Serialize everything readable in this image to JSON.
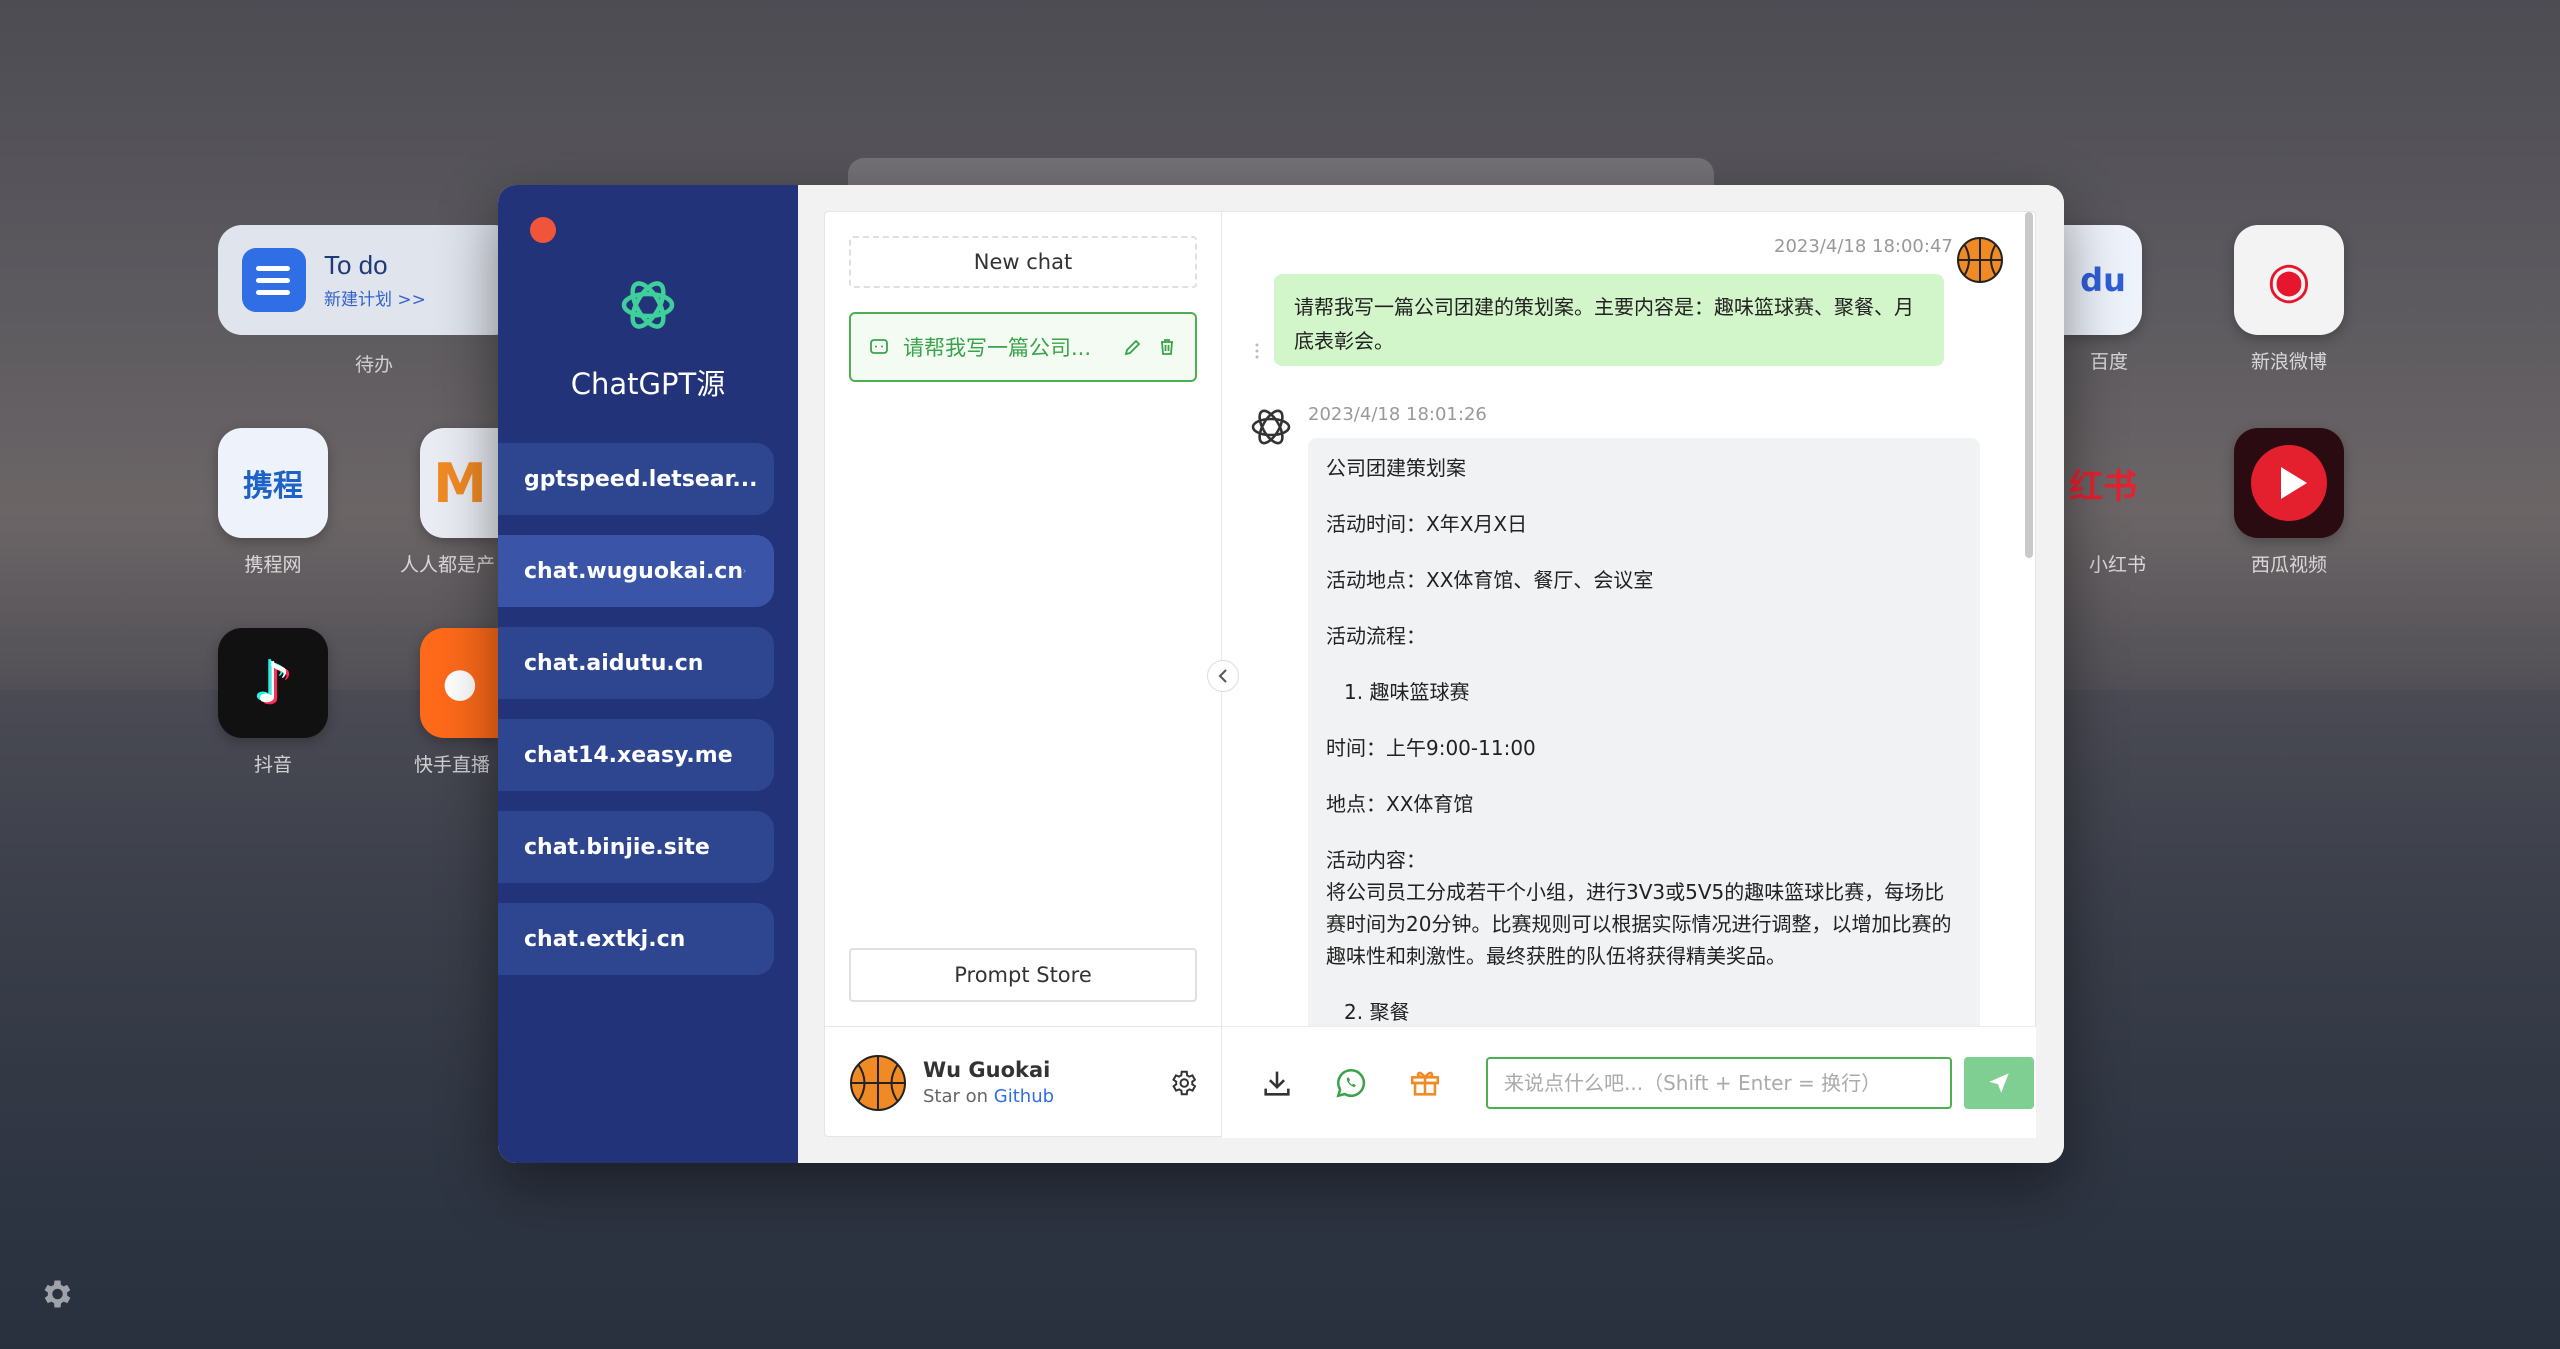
{
  "desktop": {
    "todo_widget": {
      "title": "To do",
      "subtitle": "新建计划 >>",
      "label": "待办"
    },
    "icons": [
      {
        "label": "携程网",
        "name": "ctrip"
      },
      {
        "label": "人人都是产",
        "name": "woshipm"
      },
      {
        "label": "抖音",
        "name": "douyin"
      },
      {
        "label": "快手直播",
        "name": "kuaishou"
      },
      {
        "label": "百度",
        "name": "baidu"
      },
      {
        "label": "新浪微博",
        "name": "weibo"
      },
      {
        "label": "小红书",
        "name": "xiaohongshu"
      },
      {
        "label": "西瓜视频",
        "name": "xigua"
      }
    ],
    "ctrip_tile_text": "携程",
    "baidu_tile_text": "du",
    "xhs_tile_text": "红书"
  },
  "sidebar": {
    "title": "ChatGPT源",
    "sites": [
      {
        "label": "gptspeed.letsear..."
      },
      {
        "label": "chat.wuguokai.cn"
      },
      {
        "label": "chat.aidutu.cn"
      },
      {
        "label": "chat14.xeasy.me"
      },
      {
        "label": "chat.binjie.site"
      },
      {
        "label": "chat.extkj.cn"
      }
    ]
  },
  "chats": {
    "new_chat_label": "New chat",
    "items": [
      {
        "title": "请帮我写一篇公司..."
      }
    ],
    "prompt_store_label": "Prompt Store"
  },
  "user": {
    "name": "Wu Guokai",
    "star_prefix": "Star on",
    "link_label": "Github"
  },
  "conversation": {
    "user_msg": {
      "time": "2023/4/18 18:00:47",
      "text": "请帮我写一篇公司团建的策划案。主要内容是：趣味篮球赛、聚餐、月底表彰会。"
    },
    "bot_msg": {
      "time": "2023/4/18 18:01:26",
      "lines": [
        "公司团建策划案",
        "活动时间：X年X月X日",
        "活动地点：XX体育馆、餐厅、会议室",
        "活动流程：",
        "1. 趣味篮球赛",
        "时间：上午9:00-11:00",
        "地点：XX体育馆",
        "活动内容：",
        "将公司员工分成若干个小组，进行3V3或5V5的趣味篮球比赛，每场比赛时间为20分钟。比赛规则可以根据实际情况进行调整，以增加比赛的趣味性和刺激性。最终获胜的队伍将获得精美奖品。",
        "2. 聚餐"
      ]
    }
  },
  "composer": {
    "placeholder": "来说点什么吧...（Shift + Enter = 换行）",
    "value": ""
  },
  "colors": {
    "sidebar_bg": "#22337a",
    "accent_green": "#4caf50",
    "user_bubble": "#d2f5c9",
    "close_dot": "#f0553a"
  }
}
